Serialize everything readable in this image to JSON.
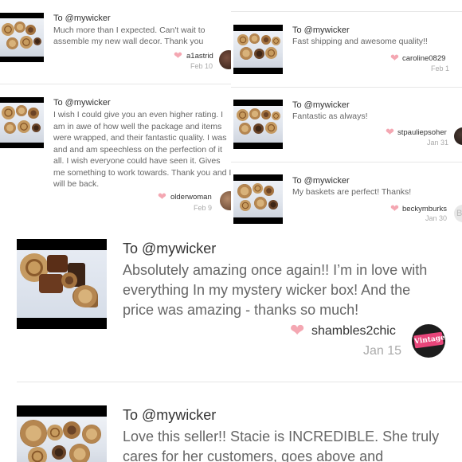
{
  "reviews": [
    {
      "to": "To @mywicker",
      "message": "Much more than I expected. Can't wait to assemble my new wall decor. Thank you",
      "user": "a1astrid",
      "date": "Feb 10"
    },
    {
      "to": "To @mywicker",
      "message": "Fast shipping and awesome quality!!",
      "user": "caroline0829",
      "date": "Feb 1"
    },
    {
      "to": "To @mywicker",
      "message": "I wish I could give you an even higher rating. I am in awe of how well the package and items were wrapped, and their fantastic quality. I was and and am speechless on the perfection of it all. I wish everyone could have seen it. Gives me something to work towards. Thank you and I will be back.",
      "user": "olderwoman",
      "date": "Feb 9"
    },
    {
      "to": "To @mywicker",
      "message": "Fantastic as always!",
      "user": "stpauliepsoher",
      "date": "Jan 31"
    },
    {
      "to": "To @mywicker",
      "message": "My baskets are perfect! Thanks!",
      "user": "beckymburks",
      "date": "Jan 30"
    },
    {
      "to": "To @mywicker",
      "message": "Absolutely amazing once again!! I’m in love with everything In my mystery wicker box! And the price was amazing - thanks so much!",
      "user": "shambles2chic",
      "date": "Jan 15",
      "avatar_text": "Vintage"
    },
    {
      "to": "To @mywicker",
      "message": "Love this seller!! Stacie is INCREDIBLE. She truly cares for her customers, goes above and"
    }
  ],
  "icons": {
    "like": "heart-icon"
  },
  "colors": {
    "heart": "#f4a7b2",
    "avatar_badge": "#e8457a"
  }
}
